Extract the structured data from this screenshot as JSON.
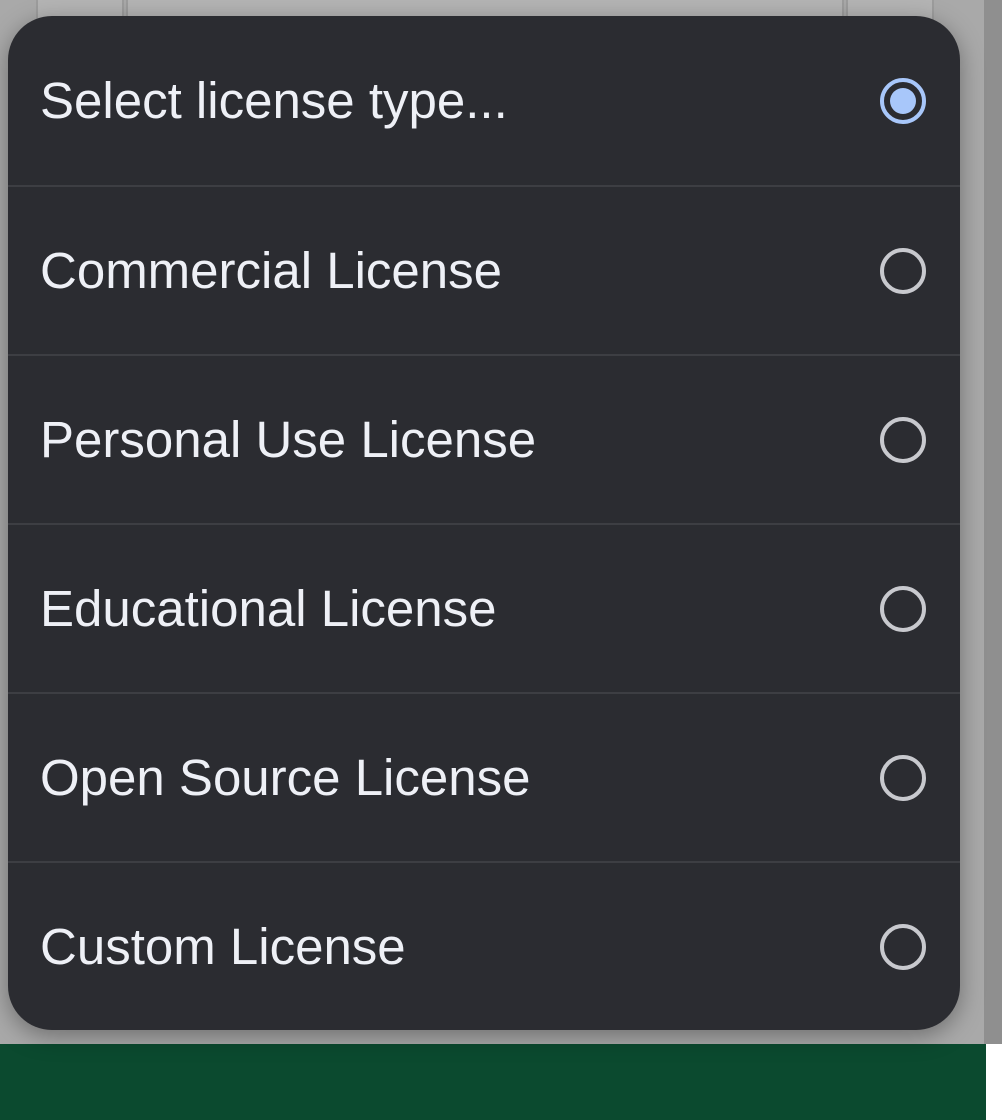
{
  "dialog": {
    "options": [
      {
        "label": "Select license type...",
        "selected": true
      },
      {
        "label": "Commercial License",
        "selected": false
      },
      {
        "label": "Personal Use License",
        "selected": false
      },
      {
        "label": "Educational License",
        "selected": false
      },
      {
        "label": "Open Source License",
        "selected": false
      },
      {
        "label": "Custom License",
        "selected": false
      }
    ]
  },
  "colors": {
    "dialog_background": "#2b2c31",
    "text": "#eef0f6",
    "radio_selected": "#a8c7fa",
    "radio_unselected": "#c8c9ce",
    "footer": "#0b4a2f"
  },
  "icons": {
    "radio_selected": "radio-checked-icon",
    "radio_unselected": "radio-unchecked-icon"
  }
}
